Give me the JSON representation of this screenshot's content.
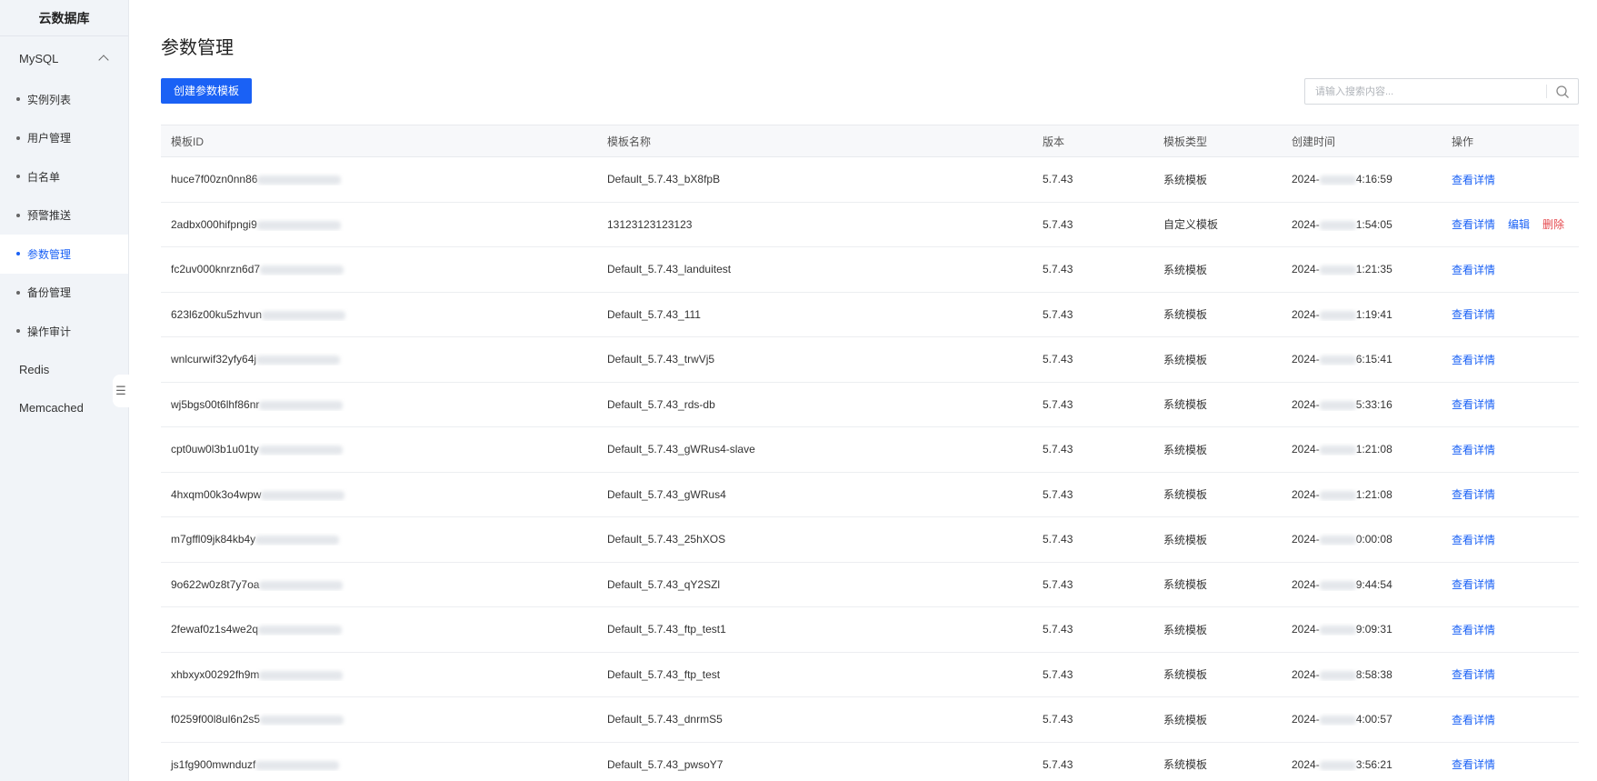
{
  "sidebar": {
    "title": "云数据库",
    "group": "MySQL",
    "items": [
      "实例列表",
      "用户管理",
      "白名单",
      "预警推送",
      "参数管理",
      "备份管理",
      "操作审计"
    ],
    "active_index": 4,
    "others": [
      "Redis",
      "Memcached"
    ]
  },
  "main": {
    "title": "参数管理",
    "create_button": "创建参数模板",
    "search_placeholder": "请输入搜索内容..."
  },
  "table": {
    "headers": [
      "模板ID",
      "模板名称",
      "版本",
      "模板类型",
      "创建时间",
      "操作"
    ],
    "actions": {
      "view": "查看详情",
      "edit": "编辑",
      "delete": "删除"
    },
    "rows": [
      {
        "id": "huce7f00zn0nn86",
        "name": "Default_5.7.43_bX8fpB",
        "version": "5.7.43",
        "type": "系统模板",
        "date_prefix": "2024-",
        "time": "4:16:59",
        "custom": false
      },
      {
        "id": "2adbx000hifpngi9",
        "name": "13123123123123",
        "version": "5.7.43",
        "type": "自定义模板",
        "date_prefix": "2024-",
        "time": "1:54:05",
        "custom": true
      },
      {
        "id": "fc2uv000knrzn6d7",
        "name": "Default_5.7.43_landuitest",
        "version": "5.7.43",
        "type": "系统模板",
        "date_prefix": "2024-",
        "time": "1:21:35",
        "custom": false
      },
      {
        "id": "623l6z00ku5zhvun",
        "name": "Default_5.7.43_111",
        "version": "5.7.43",
        "type": "系统模板",
        "date_prefix": "2024-",
        "time": "1:19:41",
        "custom": false
      },
      {
        "id": "wnlcurwif32yfy64j",
        "name": "Default_5.7.43_trwVj5",
        "version": "5.7.43",
        "type": "系统模板",
        "date_prefix": "2024-",
        "time": "6:15:41",
        "custom": false
      },
      {
        "id": "wj5bgs00t6lhf86nr",
        "name": "Default_5.7.43_rds-db",
        "version": "5.7.43",
        "type": "系统模板",
        "date_prefix": "2024-",
        "time": "5:33:16",
        "custom": false
      },
      {
        "id": "cpt0uw0l3b1u01ty",
        "name": "Default_5.7.43_gWRus4-slave",
        "version": "5.7.43",
        "type": "系统模板",
        "date_prefix": "2024-",
        "time": "1:21:08",
        "custom": false
      },
      {
        "id": "4hxqm00k3o4wpw",
        "name": "Default_5.7.43_gWRus4",
        "version": "5.7.43",
        "type": "系统模板",
        "date_prefix": "2024-",
        "time": "1:21:08",
        "custom": false
      },
      {
        "id": "m7gffl09jk84kb4y",
        "name": "Default_5.7.43_25hXOS",
        "version": "5.7.43",
        "type": "系统模板",
        "date_prefix": "2024-",
        "time": "0:00:08",
        "custom": false
      },
      {
        "id": "9o622w0z8t7y7oa",
        "name": "Default_5.7.43_qY2SZl",
        "version": "5.7.43",
        "type": "系统模板",
        "date_prefix": "2024-",
        "time": "9:44:54",
        "custom": false
      },
      {
        "id": "2fewaf0z1s4we2q",
        "name": "Default_5.7.43_ftp_test1",
        "version": "5.7.43",
        "type": "系统模板",
        "date_prefix": "2024-",
        "time": "9:09:31",
        "custom": false
      },
      {
        "id": "xhbxyx00292fh9m",
        "name": "Default_5.7.43_ftp_test",
        "version": "5.7.43",
        "type": "系统模板",
        "date_prefix": "2024-",
        "time": "8:58:38",
        "custom": false
      },
      {
        "id": "f0259f00l8ul6n2s5",
        "name": "Default_5.7.43_dnrmS5",
        "version": "5.7.43",
        "type": "系统模板",
        "date_prefix": "2024-",
        "time": "4:00:57",
        "custom": false
      },
      {
        "id": "js1fg900mwnduzf",
        "name": "Default_5.7.43_pwsoY7",
        "version": "5.7.43",
        "type": "系统模板",
        "date_prefix": "2024-",
        "time": "3:56:21",
        "custom": false
      }
    ]
  },
  "colors": {
    "primary": "#1a61f5",
    "danger": "#e5484d",
    "sidebar_bg": "#f1f4f8"
  }
}
